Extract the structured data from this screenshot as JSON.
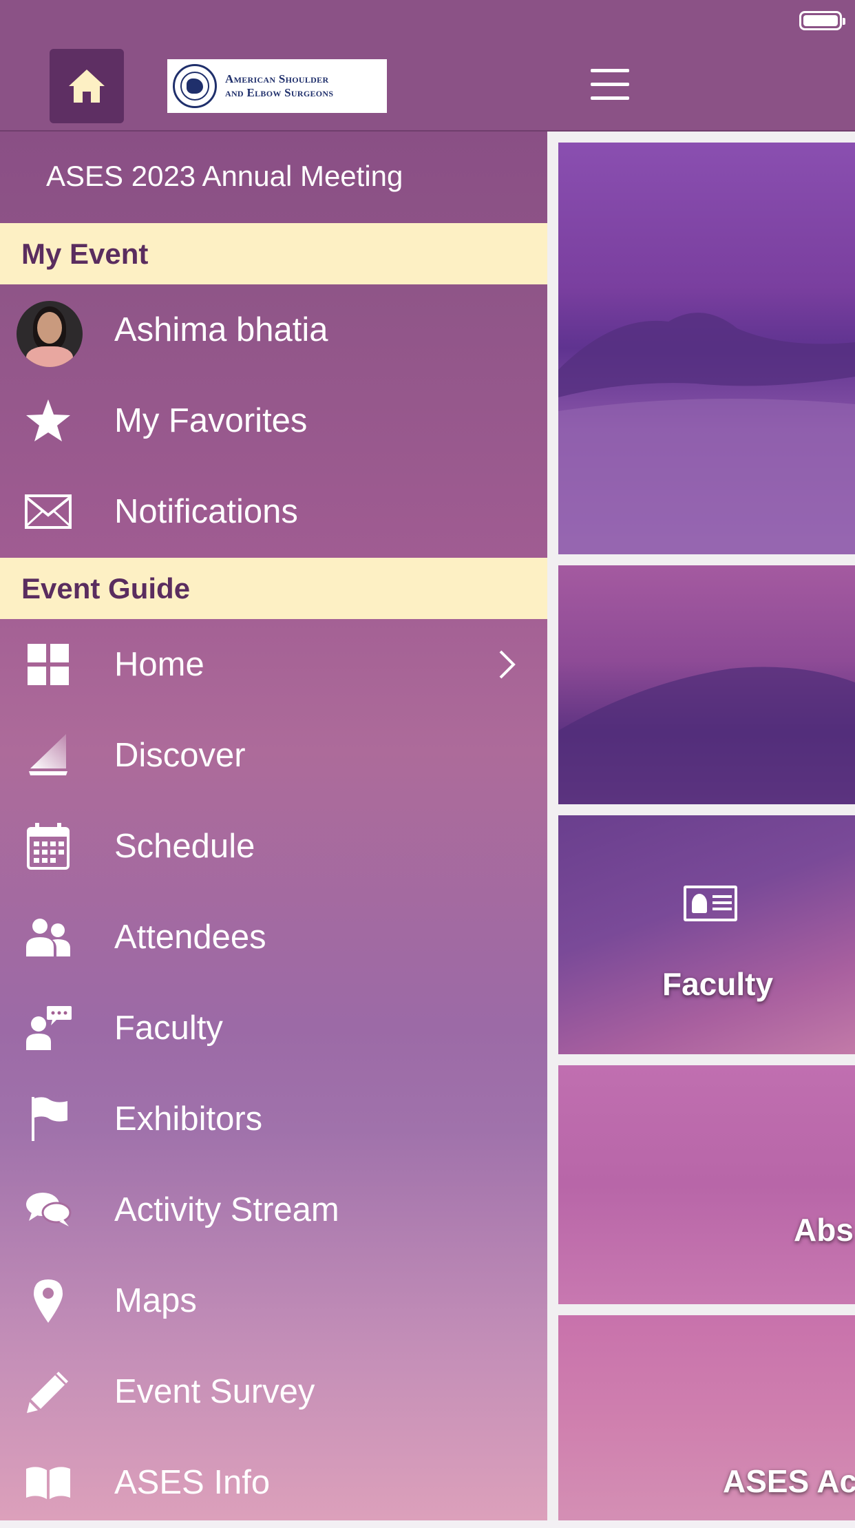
{
  "header": {
    "logo": {
      "line1": "American Shoulder",
      "line2": "and Elbow Surgeons"
    },
    "home_icon": "home-icon",
    "menu_icon": "hamburger-menu-icon"
  },
  "drawer": {
    "event_title": "ASES 2023 Annual Meeting",
    "sections": [
      {
        "title": "My Event",
        "items": [
          {
            "label": "Ashima bhatia",
            "icon": "avatar"
          },
          {
            "label": "My Favorites",
            "icon": "star-icon"
          },
          {
            "label": "Notifications",
            "icon": "envelope-icon"
          }
        ]
      },
      {
        "title": "Event Guide",
        "items": [
          {
            "label": "Home",
            "icon": "grid-icon"
          },
          {
            "label": "Discover",
            "icon": "sail-icon"
          },
          {
            "label": "Schedule",
            "icon": "calendar-icon"
          },
          {
            "label": "Attendees",
            "icon": "people-icon"
          },
          {
            "label": "Faculty",
            "icon": "speaker-icon"
          },
          {
            "label": "Exhibitors",
            "icon": "flag-icon"
          },
          {
            "label": "Activity Stream",
            "icon": "chat-bubbles-icon"
          },
          {
            "label": "Maps",
            "icon": "map-pin-icon"
          },
          {
            "label": "Event Survey",
            "icon": "pencil-icon"
          },
          {
            "label": "ASES Info",
            "icon": "book-icon"
          }
        ]
      }
    ]
  },
  "tiles": [
    {
      "label": ""
    },
    {
      "label": ""
    },
    {
      "label": "Faculty",
      "icon": "id-card-icon"
    },
    {
      "label": "Abs"
    },
    {
      "label": "ASES Ac"
    }
  ],
  "colors": {
    "header_bg": "#8b5286",
    "section_header_bg": "#fdf0c4",
    "section_header_text": "#5a2d5f",
    "home_button_bg": "#5e2f63"
  }
}
